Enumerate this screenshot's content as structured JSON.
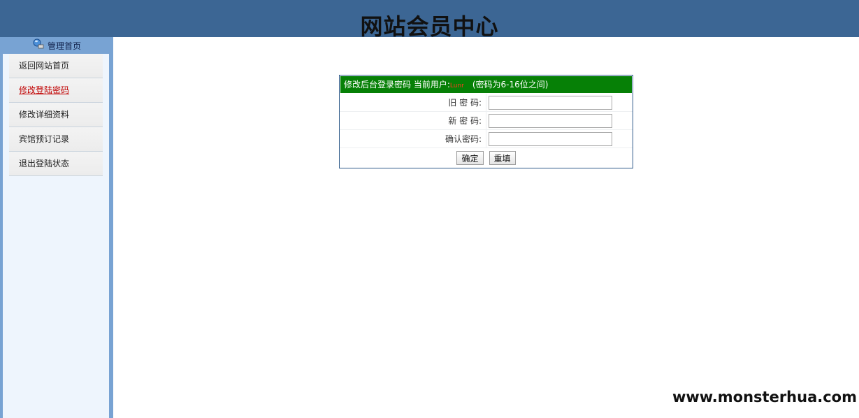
{
  "header": {
    "title": "网站会员中心"
  },
  "sidebar": {
    "head_label": "管理首页",
    "items": [
      {
        "label": "返回网站首页"
      },
      {
        "label": "修改登陆密码"
      },
      {
        "label": "修改详细资料"
      },
      {
        "label": "宾馆预订记录"
      },
      {
        "label": "退出登陆状态"
      }
    ],
    "active_index": 1
  },
  "form": {
    "title": "修改后台登录密码 当前用户:",
    "current_user": "Lunr",
    "hint": "(密码为6-16位之间)",
    "old_password_label": "旧 密 码:",
    "new_password_label": "新 密 码:",
    "confirm_password_label": "确认密码:",
    "old_password_value": "",
    "new_password_value": "",
    "confirm_password_value": "",
    "submit_label": "确定",
    "reset_label": "重填"
  },
  "watermark": {
    "text": "www.monsterhua.com"
  },
  "colors": {
    "header_bg": "#3c6694",
    "sidebar_bg": "#78a3d3",
    "panel_head_bg": "#068006",
    "active_link": "#c00000"
  }
}
